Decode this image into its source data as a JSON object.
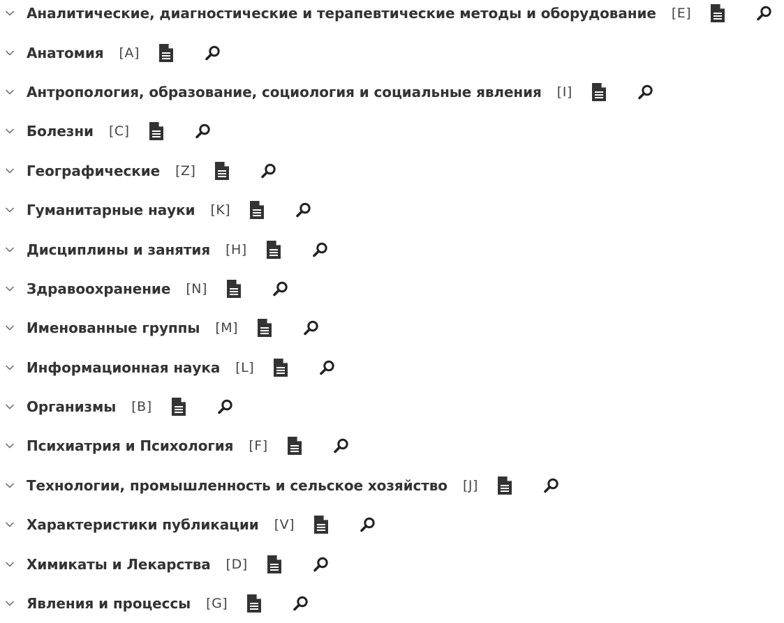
{
  "tree": {
    "items": [
      {
        "label": "Аналитические, диагностические и терапевтические методы и оборудование",
        "code": "[E]"
      },
      {
        "label": "Анатомия",
        "code": "[A]"
      },
      {
        "label": "Антропология, образование, социология и социальные явления",
        "code": "[I]"
      },
      {
        "label": "Болезни",
        "code": "[C]"
      },
      {
        "label": "Географические",
        "code": "[Z]"
      },
      {
        "label": "Гуманитарные науки",
        "code": "[K]"
      },
      {
        "label": "Дисциплины и занятия",
        "code": "[H]"
      },
      {
        "label": "Здравоохранение",
        "code": "[N]"
      },
      {
        "label": "Именованные группы",
        "code": "[M]"
      },
      {
        "label": "Информационная наука",
        "code": "[L]"
      },
      {
        "label": "Организмы",
        "code": "[B]"
      },
      {
        "label": "Психиатрия и Психология",
        "code": "[F]"
      },
      {
        "label": "Технологии, промышленность и сельское хозяйство",
        "code": "[J]"
      },
      {
        "label": "Характеристики публикации",
        "code": "[V]"
      },
      {
        "label": "Химикаты и Лекарства",
        "code": "[D]"
      },
      {
        "label": "Явления и процессы",
        "code": "[G]"
      }
    ],
    "icons": {
      "expand": "chevron-down-icon",
      "document": "document-icon",
      "search": "search-icon"
    }
  }
}
